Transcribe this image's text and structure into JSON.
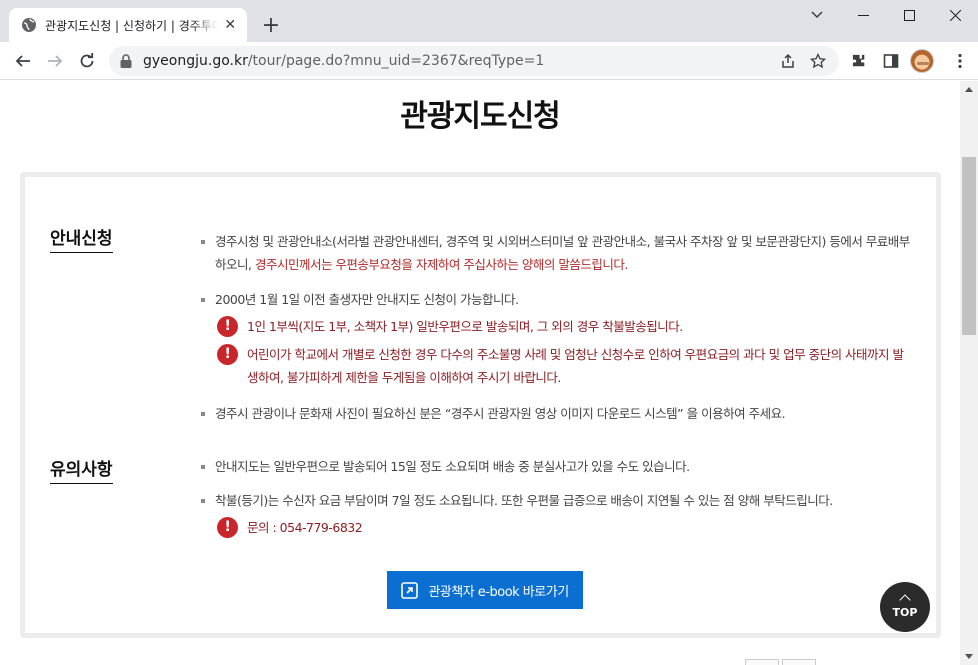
{
  "browser": {
    "tab_title": "관광지도신청 | 신청하기 | 경주투어",
    "tab_close": "✕",
    "new_tab": "+",
    "url_host": "gyeongju.go.kr",
    "url_path": "/tour/page.do?mnu_uid=2367&reqType=1",
    "icons": [
      "globe-icon",
      "back-icon",
      "forward-icon",
      "reload-icon",
      "lock-icon",
      "share-icon",
      "star-icon",
      "extensions-icon",
      "sidepanel-icon",
      "avatar"
    ]
  },
  "page": {
    "title": "관광지도신청",
    "sections": {
      "guide": {
        "label": "안내신청",
        "bullet1_a": "경주시청 및 관광안내소(서라벌 관광안내센터, 경주역 및 시외버스터미널 앞 관광안내소, 불국사 주차장 앞 및 보문관광단지) 등에서 무료배부 하오니, ",
        "bullet1_b": "경주시민께서는 우편송부요청을 자제하여 주십사하는 양해의 말씀드립니다.",
        "bullet2": "2000년 1월 1일 이전 출생자만 안내지도 신청이 가능합니다.",
        "warn1": "1인 1부씩(지도 1부, 소책자 1부) 일반우편으로 발송되며, 그 외의 경우 착불발송됩니다.",
        "warn2": "어린이가 학교에서 개별로 신청한 경우 다수의 주소불명 사례 및 엄청난 신청수로 인하여 우편요금의 과다 및 업무 중단의 사태까지 발생하여, 불가피하게 제한을 두게됨을 이해하여 주시기 바랍니다.",
        "bullet3": "경주시 관광이나 문화재 사진이 필요하신 분은 “경주시 관광자원 영상 이미지 다운로드 시스템” 을 이용하여 주세요."
      },
      "notice": {
        "label": "유의사항",
        "bullet1": "안내지도는 일반우편으로 발송되어 15일 정도 소요되며 배송 중 분실사고가 있을 수도 있습니다.",
        "bullet2": "착불(등기)는 수신자 요금 부담이며 7일 정도 소요됩니다. 또한 우편물 급증으로 배송이 지연될 수 있는 점 양해 부탁드립니다.",
        "warn1": "문의 : 054-779-6832"
      }
    },
    "ebook_button": "관광책자 e-book 바로가기",
    "top_button": "TOP",
    "warn_glyph": "!"
  },
  "colors": {
    "accent_blue": "#0a6fd0",
    "warning_red": "#c8262b",
    "warning_text": "#8b1f24"
  }
}
